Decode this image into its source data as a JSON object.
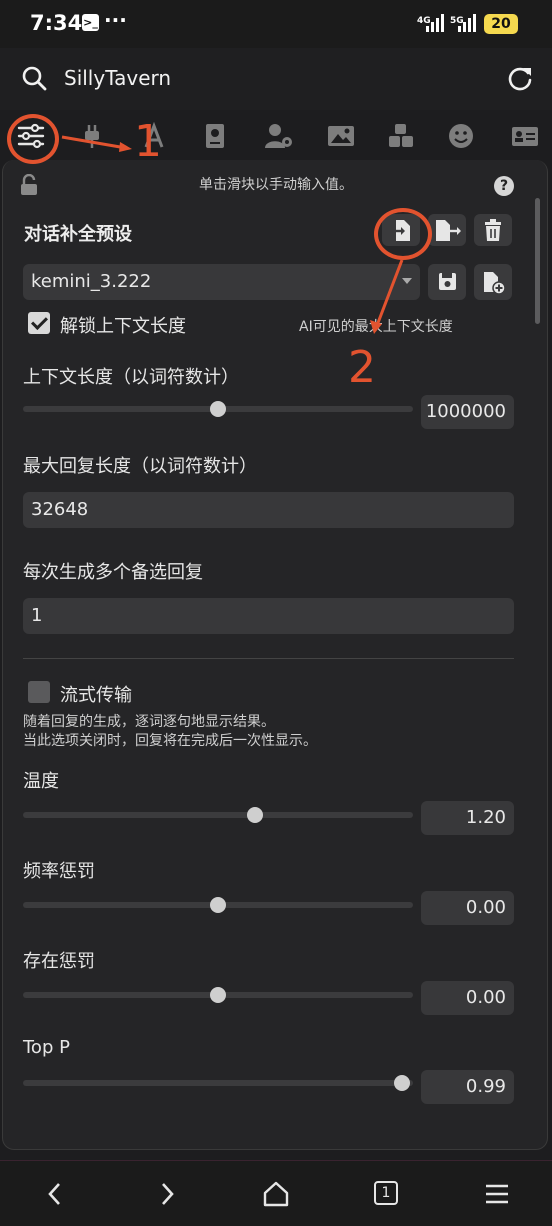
{
  "status_bar": {
    "time": "7:34",
    "terminal_glyph": "≻_",
    "more": "···",
    "signal_1": "4G",
    "signal_2": "5G",
    "battery": "20"
  },
  "app": {
    "title": "SillyTavern"
  },
  "toolbar_icons": [
    "sliders-icon",
    "plug-icon",
    "font-icon",
    "book-icon",
    "user-gear-icon",
    "image-icon",
    "cubes-icon",
    "smile-icon",
    "id-card-icon"
  ],
  "panel": {
    "hint": "单击滑块以手动输入值。",
    "help": "?",
    "preset_title": "对话补全预设",
    "preset_value": "kemini_3.222",
    "unlock_label": "解锁上下文长度",
    "unlock_hint": "AI可见的最大上下文长度",
    "context_label": "上下文长度（以词符数计）",
    "context_value": "1000000",
    "max_reply_label": "最大回复长度（以词符数计）",
    "max_reply_value": "32648",
    "swipes_label": "每次生成多个备选回复",
    "swipes_value": "1",
    "stream_label": "流式传输",
    "stream_desc_1": "随着回复的生成，逐词逐句地显示结果。",
    "stream_desc_2": "当此选项关闭时，回复将在完成后一次性显示。",
    "temperature_label": "温度",
    "temperature_value": "1.20",
    "freq_label": "频率惩罚",
    "freq_value": "0.00",
    "presence_label": "存在惩罚",
    "presence_value": "0.00",
    "topp_label": "Top P",
    "topp_value": "0.99"
  },
  "annotations": {
    "one": "1",
    "two": "2"
  },
  "nav": {
    "tabs_count": "1"
  },
  "colors": {
    "accent": "#e2532f",
    "battery": "#f5d94f"
  }
}
